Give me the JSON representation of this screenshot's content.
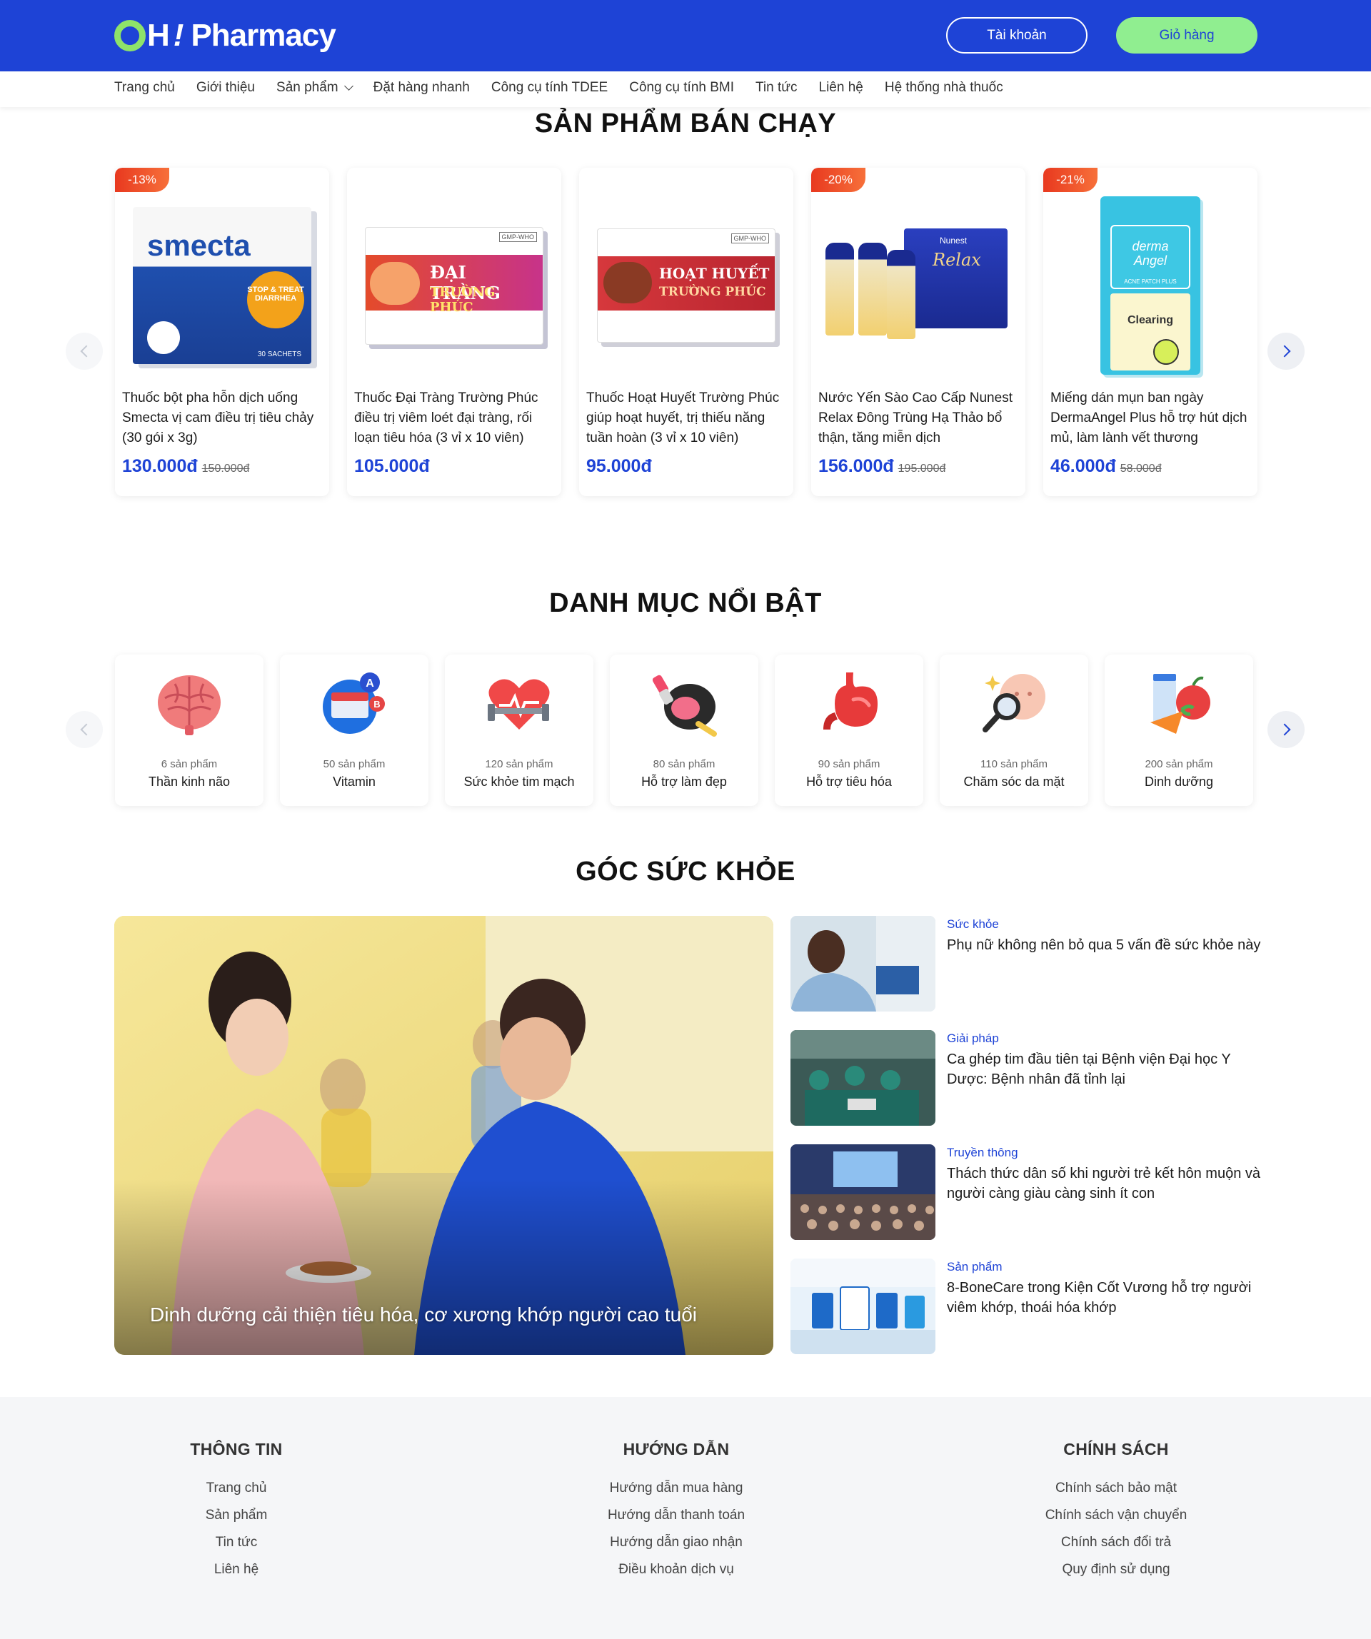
{
  "header": {
    "brand_oh": "H",
    "brand_excl": "!",
    "brand_name": "Pharmacy",
    "account_label": "Tài khoản",
    "cart_label": "Giỏ hàng"
  },
  "nav": {
    "items": [
      "Trang chủ",
      "Giới thiệu",
      "Sản phẩm",
      "Đặt hàng nhanh",
      "Công cụ tính TDEE",
      "Công cụ tính BMI",
      "Tin tức",
      "Liên hệ",
      "Hệ thống nhà thuốc"
    ]
  },
  "bestsellers": {
    "title": "SẢN PHẨM BÁN CHẠY",
    "products": [
      {
        "badge": "-13%",
        "name": "Thuốc bột pha hỗn dịch uống Smecta vị cam điều trị tiêu chảy (30 gói x 3g)",
        "price": "130.000đ",
        "old_price": "150.000đ",
        "box_brand": "smecta",
        "box_sub": "STOP & TREAT DIARRHEA",
        "box_foot": "30 SACHETS"
      },
      {
        "badge": "",
        "name": "Thuốc Đại Tràng Trường Phúc điều trị viêm loét đại tràng, rối loạn tiêu hóa (3 vỉ x 10 viên)",
        "price": "105.000đ",
        "old_price": "",
        "box_brand": "ĐẠI TRÀNG",
        "box_sub": "TRƯỜNG PHÚC",
        "box_foot": "GMP-WHO"
      },
      {
        "badge": "",
        "name": "Thuốc Hoạt Huyết Trường Phúc giúp hoạt huyết, trị thiếu năng tuần hoàn (3 vỉ x 10 viên)",
        "price": "95.000đ",
        "old_price": "",
        "box_brand": "HOẠT HUYẾT",
        "box_sub": "TRƯỜNG PHÚC",
        "box_foot": "GMP-WHO"
      },
      {
        "badge": "-20%",
        "name": "Nước Yến Sào Cao Cấp Nunest Relax Đông Trùng Hạ Thảo bổ thận, tăng miễn dịch",
        "price": "156.000đ",
        "old_price": "195.000đ",
        "box_brand": "Relax",
        "box_sub": "Nunest",
        "box_foot": ""
      },
      {
        "badge": "-21%",
        "name": "Miếng dán mụn ban ngày DermaAngel Plus hỗ trợ hút dịch mủ, làm lành vết thương",
        "price": "46.000đ",
        "old_price": "58.000đ",
        "box_brand": "derma Angel",
        "box_sub": "Clearing",
        "box_foot": "ACNE PATCH PLUS"
      }
    ]
  },
  "categories": {
    "title": "DANH MỤC NỔI BẬT",
    "items": [
      {
        "count": "6 sản phẩm",
        "name": "Thần kinh não",
        "icon": "brain-icon"
      },
      {
        "count": "50 sản phẩm",
        "name": "Vitamin",
        "icon": "vitamin-icon"
      },
      {
        "count": "120 sản phẩm",
        "name": "Sức khỏe tim mạch",
        "icon": "heart-dumbbell-icon"
      },
      {
        "count": "80 sản phẩm",
        "name": "Hỗ trợ làm đẹp",
        "icon": "makeup-icon"
      },
      {
        "count": "90 sản phẩm",
        "name": "Hỗ trợ tiêu hóa",
        "icon": "stomach-icon"
      },
      {
        "count": "110 sản phẩm",
        "name": "Chăm sóc da mặt",
        "icon": "skin-care-icon"
      },
      {
        "count": "200 sản phẩm",
        "name": "Dinh dưỡng",
        "icon": "nutrition-icon"
      }
    ]
  },
  "health": {
    "title": "GÓC SỨC KHỎE",
    "hero_title": "Dinh dưỡng cải thiện tiêu hóa, cơ xương khớp người cao tuổi",
    "articles": [
      {
        "category": "Sức khỏe",
        "title": "Phụ nữ không nên bỏ qua 5 vấn đề sức khỏe này"
      },
      {
        "category": "Giải pháp",
        "title": "Ca ghép tim đầu tiên tại Bệnh viện Đại học Y Dược: Bệnh nhân đã tỉnh lại"
      },
      {
        "category": "Truyền thông",
        "title": "Thách thức dân số khi người trẻ kết hôn muộn và người càng giàu càng sinh ít con"
      },
      {
        "category": "Sản phẩm",
        "title": "8-BoneCare trong Kiện Cốt Vương hỗ trợ người viêm khớp, thoái hóa khớp"
      }
    ]
  },
  "footer": {
    "columns": [
      {
        "title": "THÔNG TIN",
        "links": [
          "Trang chủ",
          "Sản phẩm",
          "Tin tức",
          "Liên hệ"
        ]
      },
      {
        "title": "HƯỚNG DẪN",
        "links": [
          "Hướng dẫn mua hàng",
          "Hướng dẫn thanh toán",
          "Hướng dẫn giao nhận",
          "Điều khoản dịch vụ"
        ]
      },
      {
        "title": "CHÍNH SÁCH",
        "links": [
          "Chính sách bảo mật",
          "Chính sách vận chuyển",
          "Chính sách đổi trả",
          "Quy định sử dụng"
        ]
      }
    ]
  },
  "colors": {
    "primary": "#1e43d6",
    "accent_green": "#90ee90",
    "sale_badge": "#ee4a22",
    "footer_bg": "#f5f6f8"
  }
}
